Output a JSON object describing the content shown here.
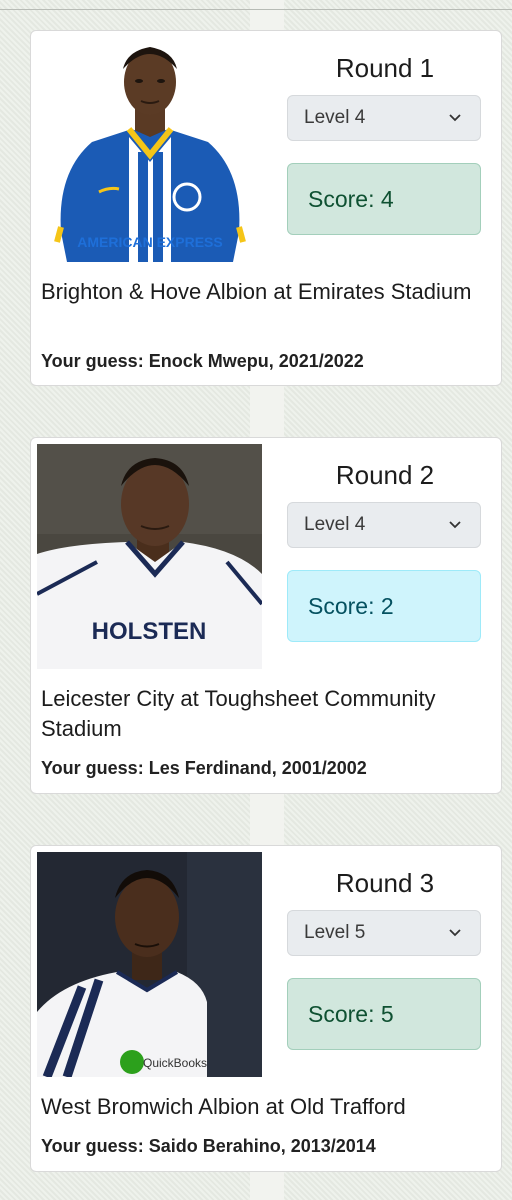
{
  "rounds": [
    {
      "round_label": "Round 1",
      "level_value": "Level 4",
      "score_label": "Score: 4",
      "venue": "Brighton & Hove Albion at Emirates Stadium",
      "guess_prefix": "Your guess:",
      "guess_value": "Enock Mwepu, 2021/2022",
      "photo_sponsor": "AMERICAN EXPRESS",
      "score_color": "#d1e7dd"
    },
    {
      "round_label": "Round 2",
      "level_value": "Level 4",
      "score_label": "Score: 2",
      "venue": "Leicester City at Toughsheet Community Stadium",
      "guess_prefix": "Your guess:",
      "guess_value": "Les Ferdinand, 2001/2002",
      "photo_sponsor": "HOLSTEN",
      "score_color": "#cff4fc"
    },
    {
      "round_label": "Round 3",
      "level_value": "Level 5",
      "score_label": "Score: 5",
      "venue": "West Bromwich Albion at Old Trafford",
      "guess_prefix": "Your guess:",
      "guess_value": "Saido Berahino, 2013/2014",
      "photo_sponsor": "QuickBooks",
      "score_color": "#d1e7dd"
    }
  ]
}
